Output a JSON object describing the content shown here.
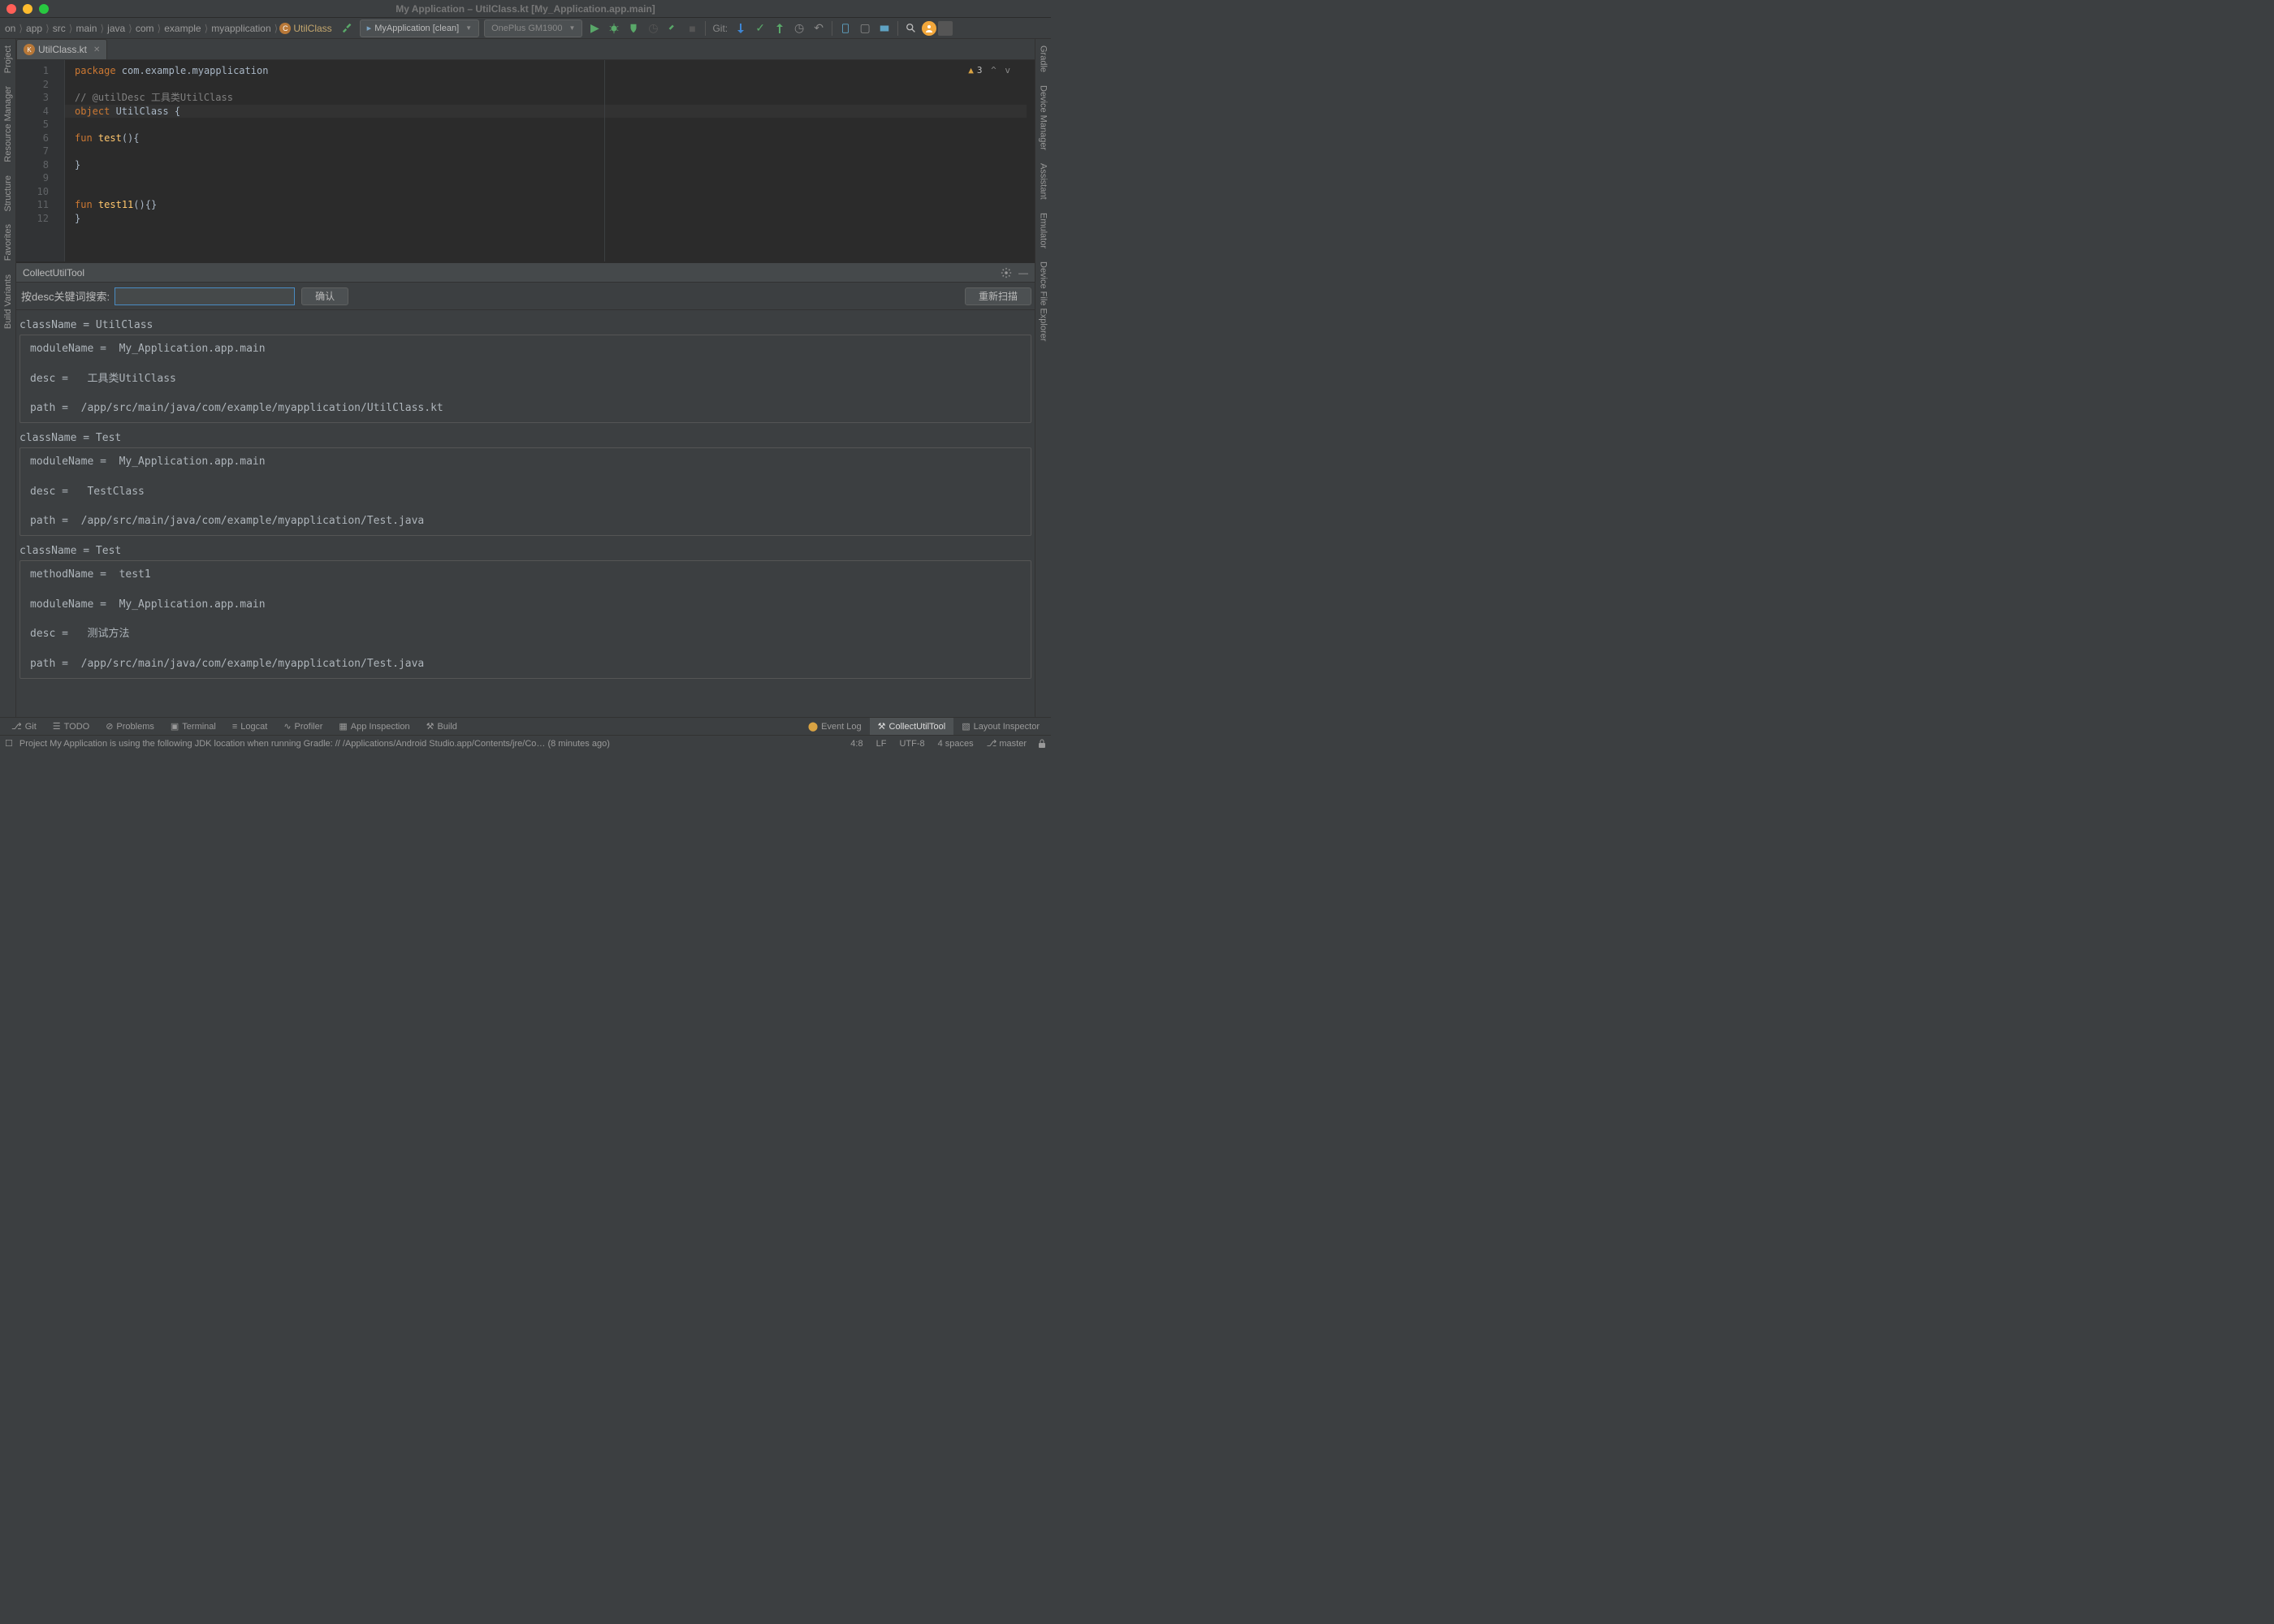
{
  "title": "My Application – UtilClass.kt [My_Application.app.main]",
  "breadcrumb": [
    "on",
    "app",
    "src",
    "main",
    "java",
    "com",
    "example",
    "myapplication"
  ],
  "breadcrumb_class": "UtilClass",
  "run_config": "MyApplication [clean]",
  "device": "OnePlus GM1900",
  "git_label": "Git:",
  "tab_filename": "UtilClass.kt",
  "editor": {
    "line_numbers": [
      "1",
      "2",
      "3",
      "4",
      "5",
      "6",
      "7",
      "8",
      "9",
      "10",
      "11",
      "12"
    ],
    "warn_count": "3",
    "lines": [
      [
        {
          "c": "kw",
          "t": "package"
        },
        {
          "c": "",
          "t": " com.example.myapplication"
        }
      ],
      [],
      [
        {
          "c": "cm",
          "t": "// @utilDesc 工具类UtilClass"
        }
      ],
      [
        {
          "c": "kw",
          "t": "object"
        },
        {
          "c": "",
          "t": " UtilClass {"
        }
      ],
      [],
      [
        {
          "c": "",
          "t": "    "
        },
        {
          "c": "kw",
          "t": "fun"
        },
        {
          "c": "",
          "t": " "
        },
        {
          "c": "fn",
          "t": "test"
        },
        {
          "c": "",
          "t": "(){"
        }
      ],
      [],
      [
        {
          "c": "",
          "t": "    }"
        }
      ],
      [],
      [],
      [
        {
          "c": "",
          "t": "    "
        },
        {
          "c": "kw",
          "t": "fun"
        },
        {
          "c": "",
          "t": " "
        },
        {
          "c": "fn",
          "t": "test11"
        },
        {
          "c": "",
          "t": "(){}"
        }
      ],
      [
        {
          "c": "",
          "t": "}"
        }
      ]
    ]
  },
  "tool": {
    "title": "CollectUtilTool",
    "search_label": "按desc关键词搜索:",
    "confirm": "确认",
    "rescan": "重新扫描",
    "results": [
      {
        "header": "className = UtilClass",
        "body": "moduleName =  My_Application.app.main\n\ndesc =   工具类UtilClass\n\npath =  /app/src/main/java/com/example/myapplication/UtilClass.kt"
      },
      {
        "header": "className = Test",
        "body": "moduleName =  My_Application.app.main\n\ndesc =   TestClass\n\npath =  /app/src/main/java/com/example/myapplication/Test.java"
      },
      {
        "header": "className = Test",
        "body": "methodName =  test1\n\nmoduleName =  My_Application.app.main\n\ndesc =   测试方法\n\npath =  /app/src/main/java/com/example/myapplication/Test.java"
      }
    ]
  },
  "left_tools": [
    "Project",
    "Resource Manager",
    "Structure",
    "Favorites",
    "Build Variants"
  ],
  "right_tools": [
    "Gradle",
    "Device Manager",
    "Assistant",
    "Emulator",
    "Device File Explorer"
  ],
  "bottom_tools": {
    "git": "Git",
    "todo": "TODO",
    "problems": "Problems",
    "terminal": "Terminal",
    "logcat": "Logcat",
    "profiler": "Profiler",
    "inspection": "App Inspection",
    "build": "Build",
    "eventlog": "Event Log",
    "collect": "CollectUtilTool",
    "layout": "Layout Inspector"
  },
  "status": {
    "message": "Project My Application is using the following JDK location when running Gradle: // /Applications/Android Studio.app/Contents/jre/Co… (8 minutes ago)",
    "pos": "4:8",
    "lf": "LF",
    "enc": "UTF-8",
    "indent": "4 spaces",
    "branch": "master"
  }
}
